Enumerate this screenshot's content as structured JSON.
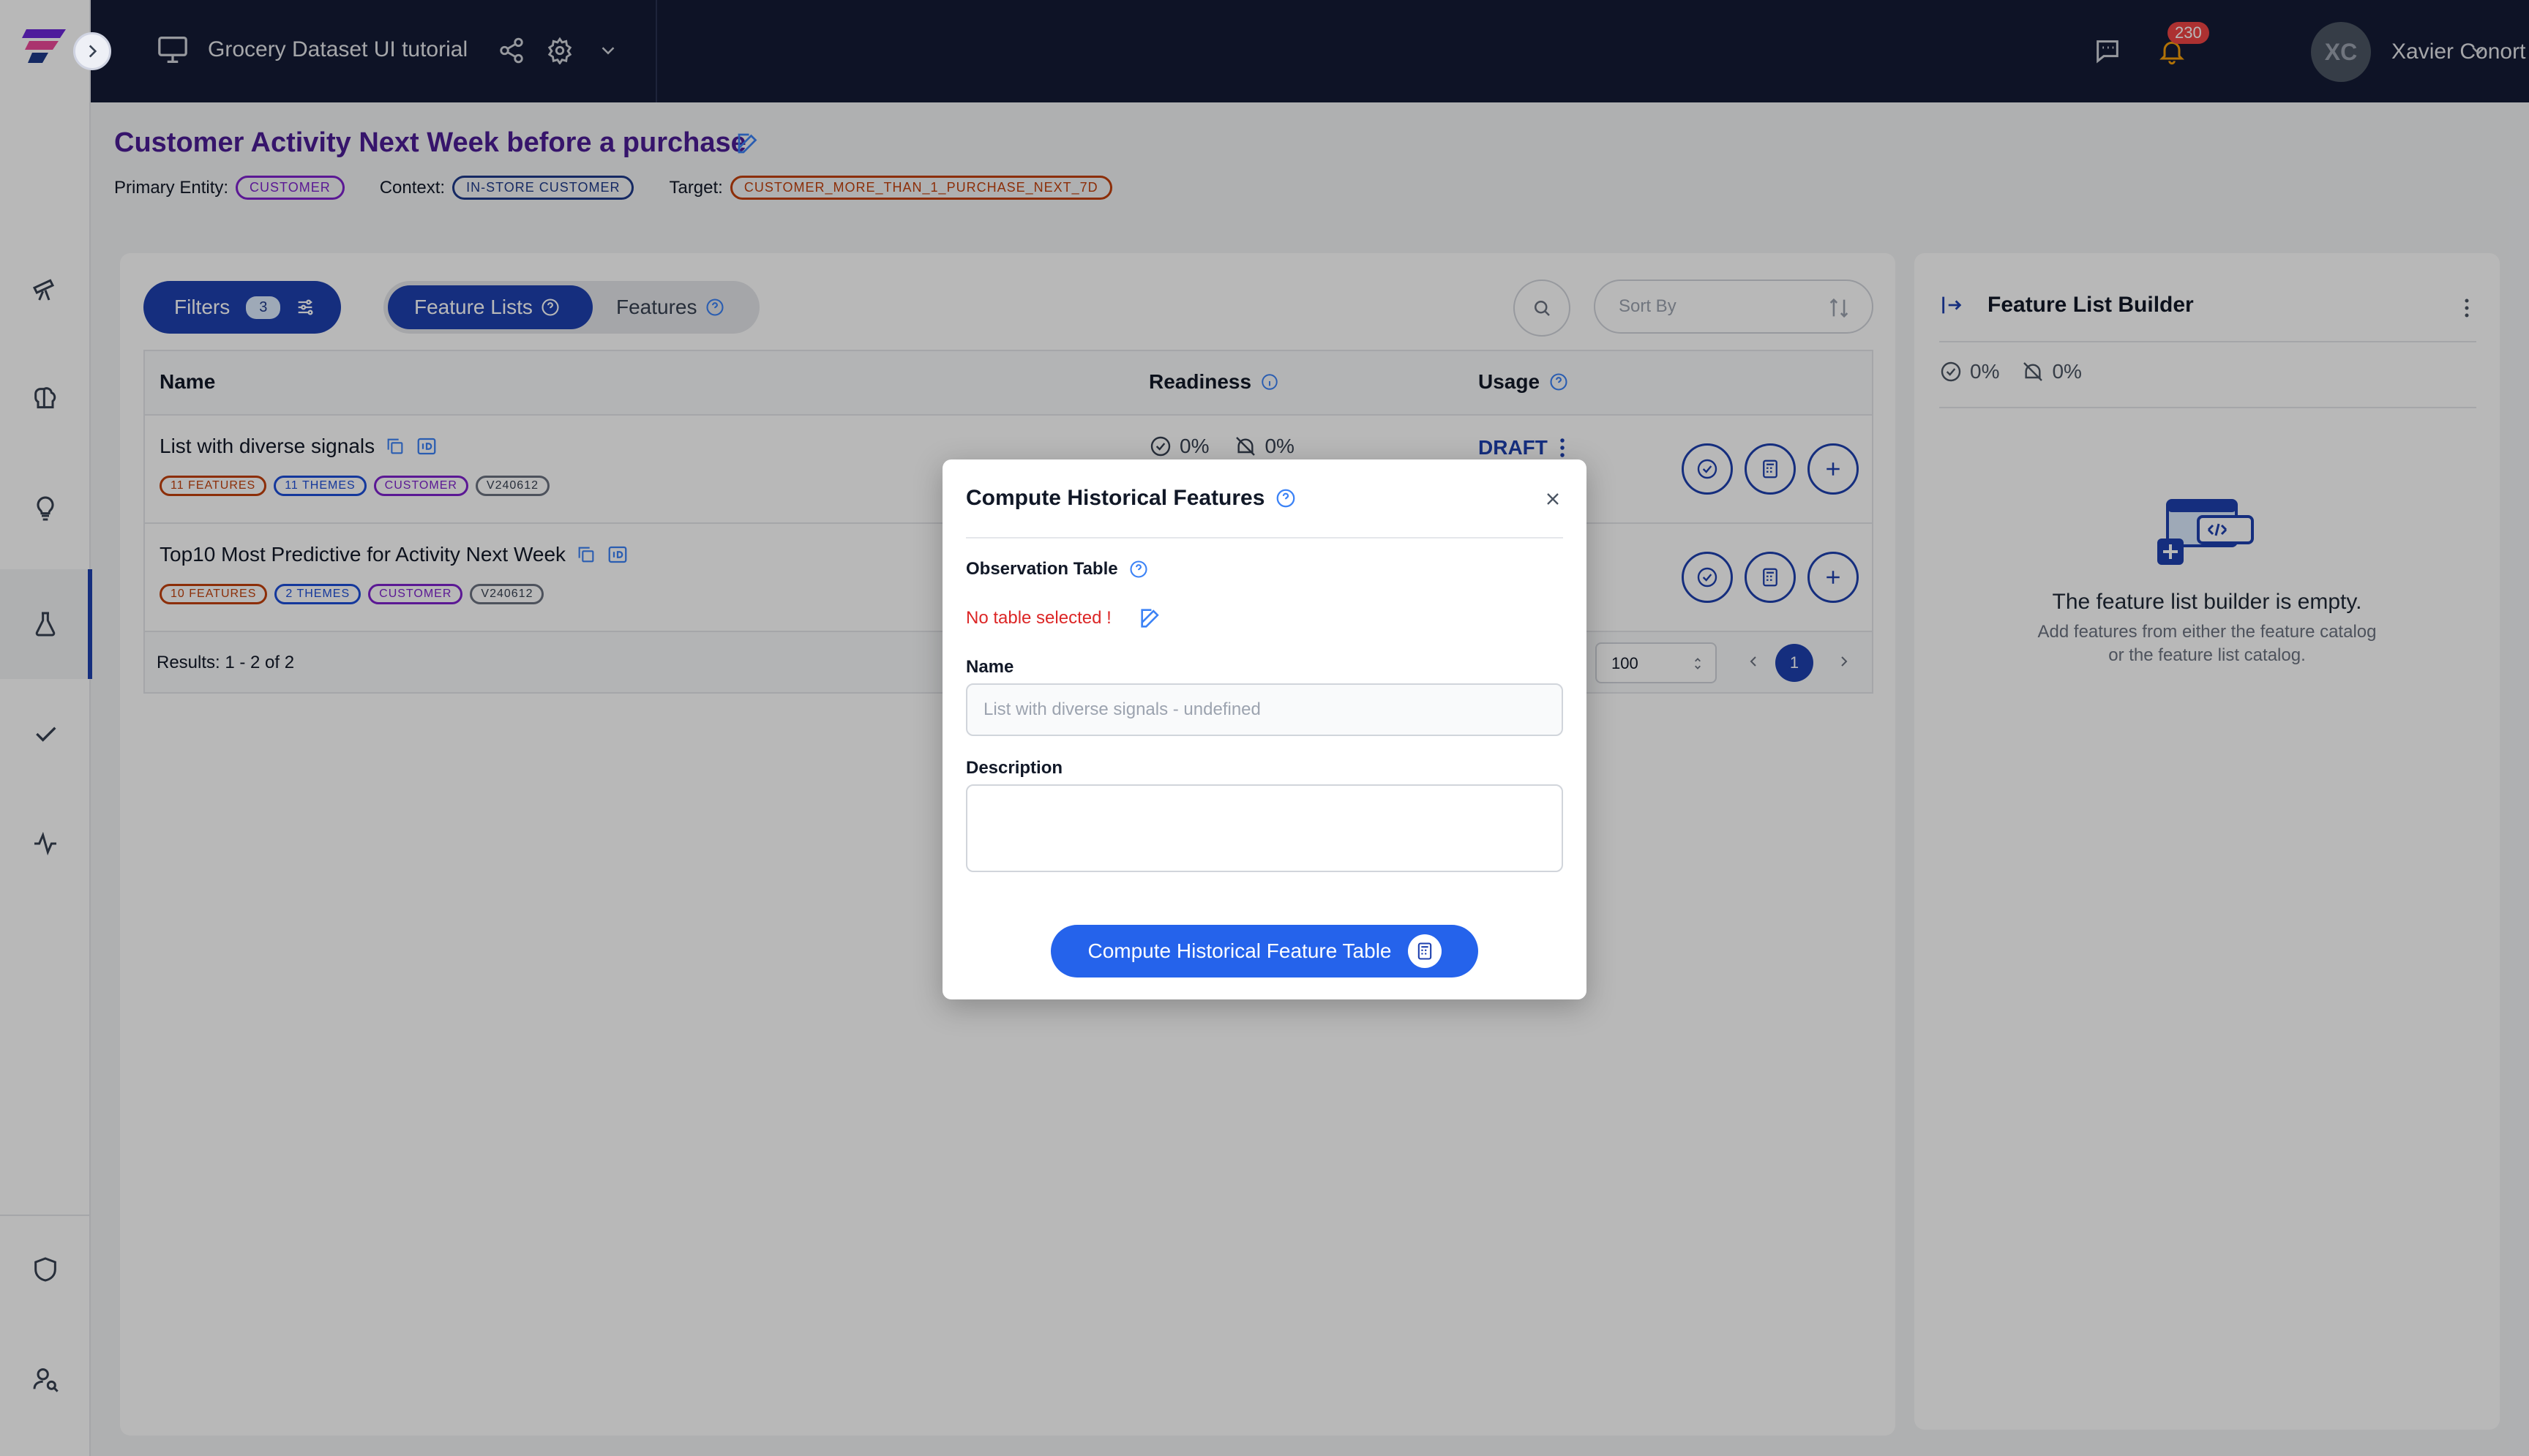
{
  "topbar": {
    "project_title": "Grocery Dataset UI tutorial",
    "notifications_count": "230",
    "user_initials": "XC",
    "user_name": "Xavier Conort"
  },
  "header": {
    "title": "Customer Activity Next Week before a purchase",
    "primary_entity_label": "Primary Entity:",
    "primary_entity": "CUSTOMER",
    "context_label": "Context:",
    "context": "IN-STORE CUSTOMER",
    "target_label": "Target:",
    "target": "CUSTOMER_MORE_THAN_1_PURCHASE_NEXT_7D"
  },
  "toolbar": {
    "filters_label": "Filters",
    "filters_count": "3",
    "tab_feature_lists": "Feature Lists",
    "tab_features": "Features",
    "sort_placeholder": "Sort By"
  },
  "table": {
    "columns": [
      "Name",
      "Readiness",
      "Usage"
    ],
    "rows": [
      {
        "name": "List with diverse signals",
        "tags": [
          "11 FEATURES",
          "11 THEMES",
          "CUSTOMER",
          "V240612"
        ],
        "readiness_ok": "0%",
        "readiness_off": "0%",
        "usage": "DRAFT"
      },
      {
        "name": "Top10 Most Predictive for Activity Next Week",
        "tags": [
          "10 FEATURES",
          "2 THEMES",
          "CUSTOMER",
          "V240612"
        ]
      }
    ],
    "results_text": "Results: 1 - 2 of 2",
    "page_size": "100",
    "current_page": "1"
  },
  "right_panel": {
    "title": "Feature List Builder",
    "stat_ok": "0%",
    "stat_off": "0%",
    "empty_title": "The feature list builder is empty.",
    "empty_line1": "Add features from either the feature catalog",
    "empty_line2": "or the feature list catalog."
  },
  "modal": {
    "title": "Compute Historical Features",
    "observation_label": "Observation Table",
    "no_table_text": "No table selected !",
    "name_label": "Name",
    "name_placeholder": "List with diverse signals - undefined",
    "description_label": "Description",
    "submit_label": "Compute Historical Feature Table"
  },
  "colors": {
    "topbar_bg": "#141b35",
    "accent": "#1e40af",
    "title_purple": "#4c1d95",
    "error_red": "#dc2626",
    "submit_blue": "#2563eb"
  },
  "icons": [
    "featurebyte-logo",
    "chevron-right-icon",
    "telescope-icon",
    "brain-icon",
    "lightbulb-icon",
    "flask-icon",
    "check-icon",
    "activity-icon",
    "shield-icon",
    "user-search-icon",
    "monitor-icon",
    "share-icon",
    "gear-icon",
    "chevron-down-icon",
    "chat-icon",
    "bell-icon",
    "edit-icon",
    "sliders-icon",
    "help-circle-icon",
    "search-icon",
    "sort-icon",
    "copy-icon",
    "id-icon",
    "check-circle-icon",
    "offline-icon",
    "kebab-icon",
    "calculator-icon",
    "plus-icon",
    "panel-collapse-icon",
    "close-icon"
  ]
}
